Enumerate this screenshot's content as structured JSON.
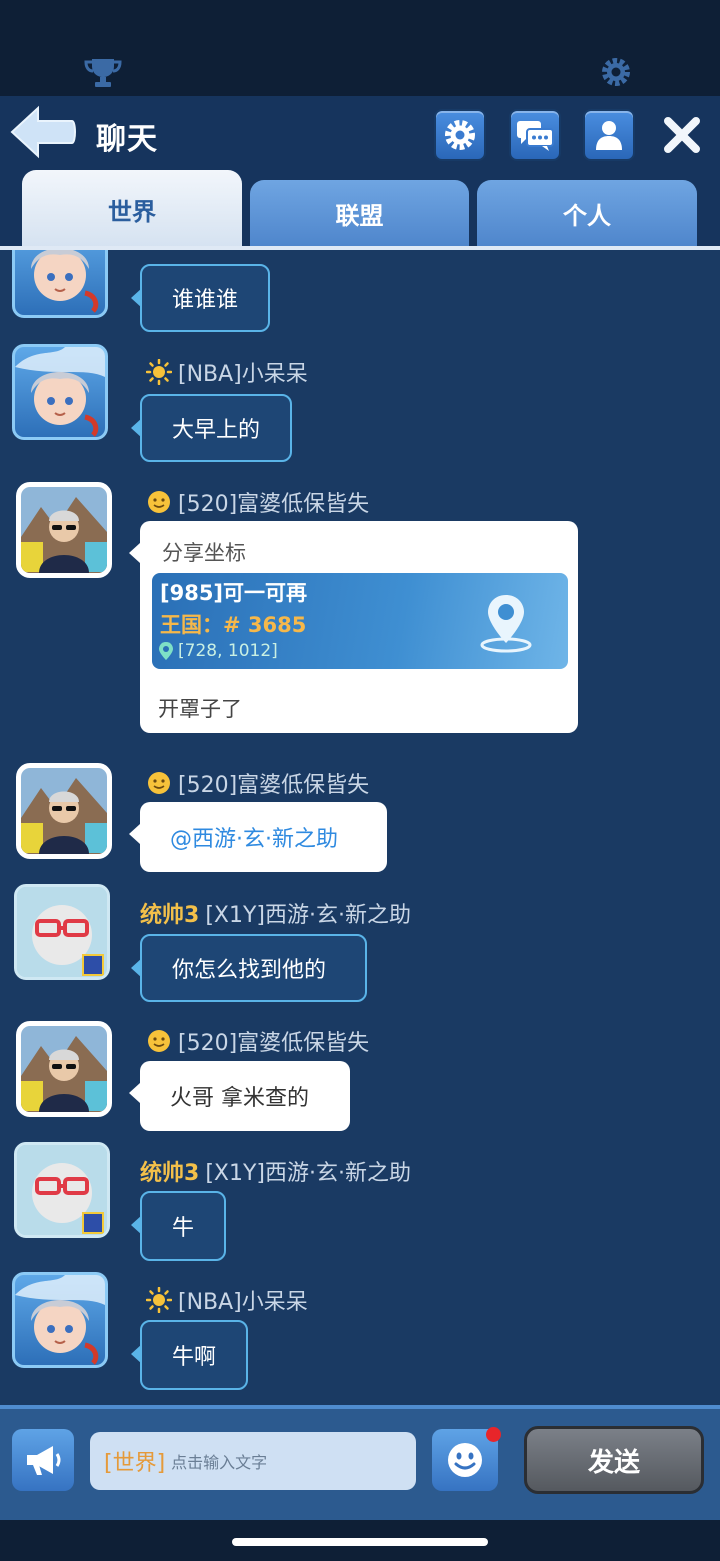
{
  "header": {
    "title": "聊天"
  },
  "tabs": [
    {
      "label": "世界",
      "active": true
    },
    {
      "label": "联盟",
      "active": false
    },
    {
      "label": "个人",
      "active": false
    }
  ],
  "messages": [
    {
      "sender_prefix": "",
      "sender": "",
      "text": "谁谁谁",
      "style": "dark"
    },
    {
      "sender_prefix": "",
      "sender": "[NBA]小呆呆",
      "text": "大早上的",
      "style": "dark"
    },
    {
      "sender_prefix": "",
      "sender": "[520]富婆低保皆失",
      "style": "share",
      "share": {
        "title": "分享坐标",
        "alliance_name": "[985]可一可再",
        "kingdom": "王国：# 3685",
        "coords": "[728, 1012]",
        "message": "开罩子了"
      }
    },
    {
      "sender_prefix": "",
      "sender": "[520]富婆低保皆失",
      "text": "@西游·玄·新之助",
      "style": "white-mention"
    },
    {
      "sender_prefix": "统帅3",
      "sender": "[X1Y]西游·玄·新之助",
      "text": "你怎么找到他的",
      "style": "dark"
    },
    {
      "sender_prefix": "",
      "sender": "[520]富婆低保皆失",
      "text": "火哥 拿米查的",
      "style": "white"
    },
    {
      "sender_prefix": "统帅3",
      "sender": "[X1Y]西游·玄·新之助",
      "text": "牛",
      "style": "dark"
    },
    {
      "sender_prefix": "",
      "sender": "[NBA]小呆呆",
      "text": "牛啊",
      "style": "dark"
    }
  ],
  "input": {
    "channel": "[世界]",
    "placeholder": "点击输入文字"
  },
  "send_label": "发送",
  "colors": {
    "background": "#1a3a63",
    "accent_blue": "#3673c2",
    "rank_gold": "#f3c04a",
    "notification_red": "#e8252a"
  }
}
